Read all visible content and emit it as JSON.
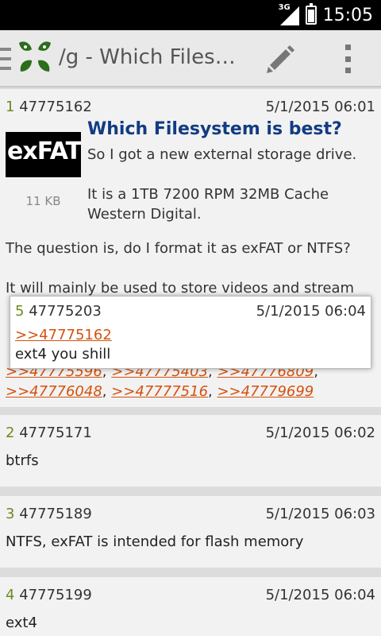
{
  "status_bar": {
    "time": "15:05",
    "network": "3G"
  },
  "action_bar": {
    "title": "/g - Which Filesy..."
  },
  "op_post": {
    "number": "1",
    "id": "47775162",
    "date": "5/1/2015 06:01",
    "subject": "Which Filesystem is best?",
    "thumbnail_text": "exFAT",
    "thumbnail_size": "11 KB",
    "line1": "So I got a new external storage drive.",
    "line2": "It is a 1TB 7200 RPM 32MB Cache Western Digital.",
    "para1": "The question is, do I format it as exFAT or NTFS?",
    "para2": "It will mainly be used to store videos and stream",
    "reply_links": [
      ">>47775596",
      ">>47775403",
      ">>47776809",
      ">>47776048",
      ">>47777516",
      ">>47779699"
    ]
  },
  "popup": {
    "number": "5",
    "id": "47775203",
    "date": "5/1/2015 06:04",
    "quote": ">>47775162",
    "text": "ext4 you shill"
  },
  "replies": [
    {
      "number": "2",
      "id": "47775171",
      "date": "5/1/2015 06:02",
      "text": "btrfs"
    },
    {
      "number": "3",
      "id": "47775189",
      "date": "5/1/2015 06:03",
      "text": "NTFS, exFAT is intended for flash memory"
    },
    {
      "number": "4",
      "id": "47775199",
      "date": "5/1/2015 06:04",
      "text": "ext4"
    }
  ]
}
